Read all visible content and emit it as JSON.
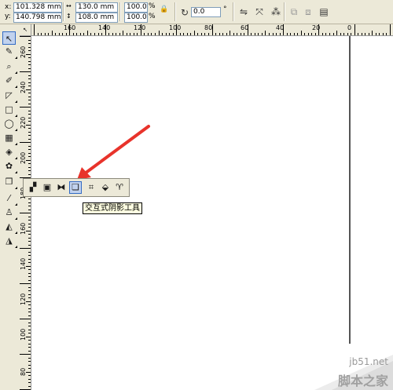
{
  "property_bar": {
    "x_label": "x:",
    "y_label": "y:",
    "x_value": "101.328 mm",
    "y_value": "140.798 mm",
    "width_value": "130.0 mm",
    "height_value": "108.0 mm",
    "scale_x": "100.0",
    "scale_y": "100.0",
    "percent_symbol": "%",
    "rotation_value": "0.0",
    "degree_symbol": "°"
  },
  "rulers": {
    "corner_glyph": "↖",
    "horizontal_labels": [
      "160",
      "140",
      "120",
      "100",
      "80",
      "60",
      "40",
      "20",
      "0"
    ],
    "vertical_labels": [
      "260",
      "240",
      "220",
      "200",
      "180",
      "160",
      "140",
      "120",
      "100",
      "80"
    ]
  },
  "toolbox": {
    "tools": [
      {
        "name": "pick-tool-icon",
        "glyph": "↖"
      },
      {
        "name": "shape-tool-icon",
        "glyph": "✎"
      },
      {
        "name": "zoom-tool-icon",
        "glyph": "⌕"
      },
      {
        "name": "freehand-tool-icon",
        "glyph": "✐"
      },
      {
        "name": "smart-fill-tool-icon",
        "glyph": "◸"
      },
      {
        "name": "rectangle-tool-icon",
        "glyph": "□"
      },
      {
        "name": "ellipse-tool-icon",
        "glyph": "◯"
      },
      {
        "name": "graph-paper-tool-icon",
        "glyph": "▦"
      },
      {
        "name": "basic-shapes-tool-icon",
        "glyph": "◈"
      },
      {
        "name": "text-tool-icon",
        "glyph": "✿"
      },
      {
        "name": "interactive-blend-tool-icon",
        "glyph": "❒"
      },
      {
        "name": "eyedropper-tool-icon",
        "glyph": "⁄"
      },
      {
        "name": "outline-tool-icon",
        "glyph": "♙"
      },
      {
        "name": "fill-tool-icon",
        "glyph": "◭"
      },
      {
        "name": "interactive-fill-tool-icon",
        "glyph": "◮"
      }
    ]
  },
  "flyout": {
    "tools": [
      {
        "name": "blend-tool-icon",
        "glyph": "▞"
      },
      {
        "name": "contour-tool-icon",
        "glyph": "▣"
      },
      {
        "name": "distort-tool-icon",
        "glyph": "⧓"
      },
      {
        "name": "drop-shadow-tool-icon",
        "glyph": "❏"
      },
      {
        "name": "envelope-tool-icon",
        "glyph": "⌗"
      },
      {
        "name": "extrude-tool-icon",
        "glyph": "⬙"
      },
      {
        "name": "transparency-tool-icon",
        "glyph": "♈"
      }
    ],
    "tooltip": "交互式阴影工具"
  },
  "watermark": {
    "site": "jb51.net",
    "brand": "脚本之家"
  },
  "colors": {
    "ui_face": "#ece9d8",
    "arrow": "#e8332b",
    "highlight": "#c1d2ee",
    "tooltip_bg": "#ffffe1"
  }
}
